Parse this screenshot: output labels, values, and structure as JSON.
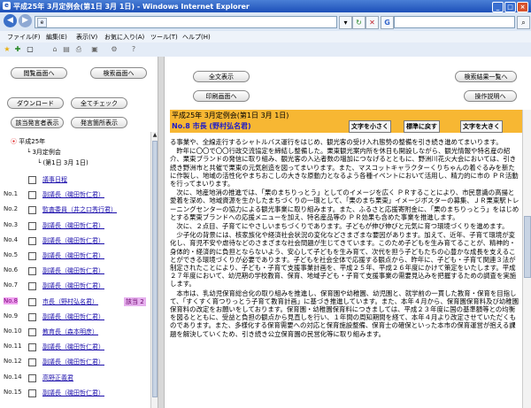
{
  "window": {
    "title": "平成25年 3月定例会(第1日 3月 1日) - Windows Internet Explorer"
  },
  "menu": [
    "ファイル(F)",
    "編集(E)",
    "表示(V)",
    "お気に入り(A)",
    "ツール(T)",
    "ヘルプ(H)"
  ],
  "left": {
    "buttons": {
      "home": "閲覧画面へ",
      "search": "検索画面へ",
      "download": "ダウンロード",
      "check_all": "全てチェック",
      "show_speakers": "該当発言者表示",
      "speaker_list": "発言箇所表示"
    },
    "tree": {
      "root": "平成25年",
      "session": "3月定例会",
      "day": "(第1日 3月 1日)"
    },
    "items": [
      {
        "num": "",
        "label": "議事日程"
      },
      {
        "num": "No.1",
        "label": "副議長（磯田哲仁君）"
      },
      {
        "num": "No.2",
        "label": "監査委員（井之口秀行君）"
      },
      {
        "num": "No.3",
        "label": "副議長（磯田哲仁君）"
      },
      {
        "num": "No.4",
        "label": "副議長（磯田哲仁君）"
      },
      {
        "num": "No.5",
        "label": "副議長（磯田哲仁君）"
      },
      {
        "num": "No.6",
        "label": "副議長（磯田哲仁君）"
      },
      {
        "num": "No.7",
        "label": "副議長（磯田哲仁君）"
      },
      {
        "num": "No.8",
        "label": "市長（野村弘名君）",
        "tag": "該当 2"
      },
      {
        "num": "No.9",
        "label": "副議長（磯田哲仁君）"
      },
      {
        "num": "No.10",
        "label": "教育長（森本明彦）"
      },
      {
        "num": "No.11",
        "label": "副議長（磯田哲仁君）"
      },
      {
        "num": "No.12",
        "label": "副議長（磯田哲仁君）"
      },
      {
        "num": "No.14",
        "label": "高野正義君"
      },
      {
        "num": "No.15",
        "label": "副議長（磯田哲仁君）"
      }
    ]
  },
  "right": {
    "buttons": {
      "full": "全文表示",
      "back_results": "検索結果一覧へ",
      "print": "印刷画面へ",
      "help": "操作説明へ"
    },
    "header": {
      "line1": "平成25年 3月定例会(第1日 3月 1日)",
      "line2": "No.8 市長 (野村弘名君)"
    },
    "font_buttons": {
      "small": "文字を小さく",
      "reset": "標準に戻す",
      "large": "文字を大きく"
    },
    "paragraphs": [
      "る事業や、全線走行するシャトルバス運行をはじめ、観光客の受け入れ態勢の整備を引き続き進めてまいります。",
      "　昨年に〇〇で〇〇行政交流協定を締結し整備した。栗東観光案内所を休日も開設しながら、観光情報や特名産の紹介、栗東ブランドの発信に取り組み、観光客の入込者数の増加につなげるとともに、野洲川花火大会においては、引き続き野洲市と共催で栗東の元気創造を図ってまいります。また、マスコットキャラクターくりちゃんの着ぐるみを新たに作製し、地域の活性化やまちおこしの大きな原動力となるよう各種イベントにおいて活用し、精力的に市の ＰＲ活動を行ってまいります。",
      "　次に、地産地消の推進では、「栗のまちりっとう」としてのイメージを広く ＰＲすることにより、市民意識の高揚と愛着を深め、地域資源を生かしたまちづくりの一環として、「栗のまち栗東」イメージボスターの募集、ＪＲ栗東駅トレーニングセンターの協力による観光事業に取り組みます。また、ふるさと応援寄附金に、「栗のまちりっとう」をはじめとする栗東ブランドへの応援メニューを加え、特名産品等の ＰＲ効果も含めた事業を推進します。",
      "　次に、２点目、子育てにやさしいまちづくりであります。子どもが伸び伸びと元気に育つ環境づくりを進めます。",
      "　少子化の背景には、核家族化や経済社会状況の変化などさまざまな要因があります。加えて、近年、子育て環境が変化し、育児不安や虐待などのさまざまな社会問題が生じてきています。このため子どもを生み育てることが、精神的・身体的・経済的に負担とならないよう、安心して子どもを生み育て、次代を担う子どもたちの心豊かな成長を支えることができる環境づくりが必要であります。子どもを社会全体で応援する観点から、昨年に、子ども・子育て関連３法が制定されたことにより、子ども・子育て支援事業計画を、平成２５年、平成２６年度にかけて策定をいたします。平成２７年度において、幼児期の学校教育、保育、地域子ども・子育て支援事業の需要見込みを把握するための調査を実施します。",
      "　本市は、乳幼児保育総合化の取り組みを推進し、保育園や幼稚園、幼児園と、就学前の一貫した教育・保育を目指して、「すくすく育つりっとう子育て教育計画」に基づき推進しています。また、本年４月から、保育園保育料及び幼稚園保育料の改定をお願いをしております。保育園・幼稚園保育料につきましては、平成２３年度に国の基準額等との均衡を図るとともに、受益と負担の観点から見直しを行い、１年間の周知期間を経て、本年４月より改定させていただくものであります。また、多様化する保育需要への対応と保育施設整備、保育士の確保といった本市の保育運営が抱える課題を解決していくため、引き続き公立保育園の民営化等に取り組みます。"
    ]
  },
  "colors": {
    "header_bg": "#f7b733",
    "link": "#1a0dab",
    "highlight": "#f0a0f0"
  },
  "icons": [
    "back-icon",
    "forward-icon",
    "refresh-icon",
    "stop-icon",
    "search-icon",
    "favorites-star-icon",
    "home-icon"
  ]
}
